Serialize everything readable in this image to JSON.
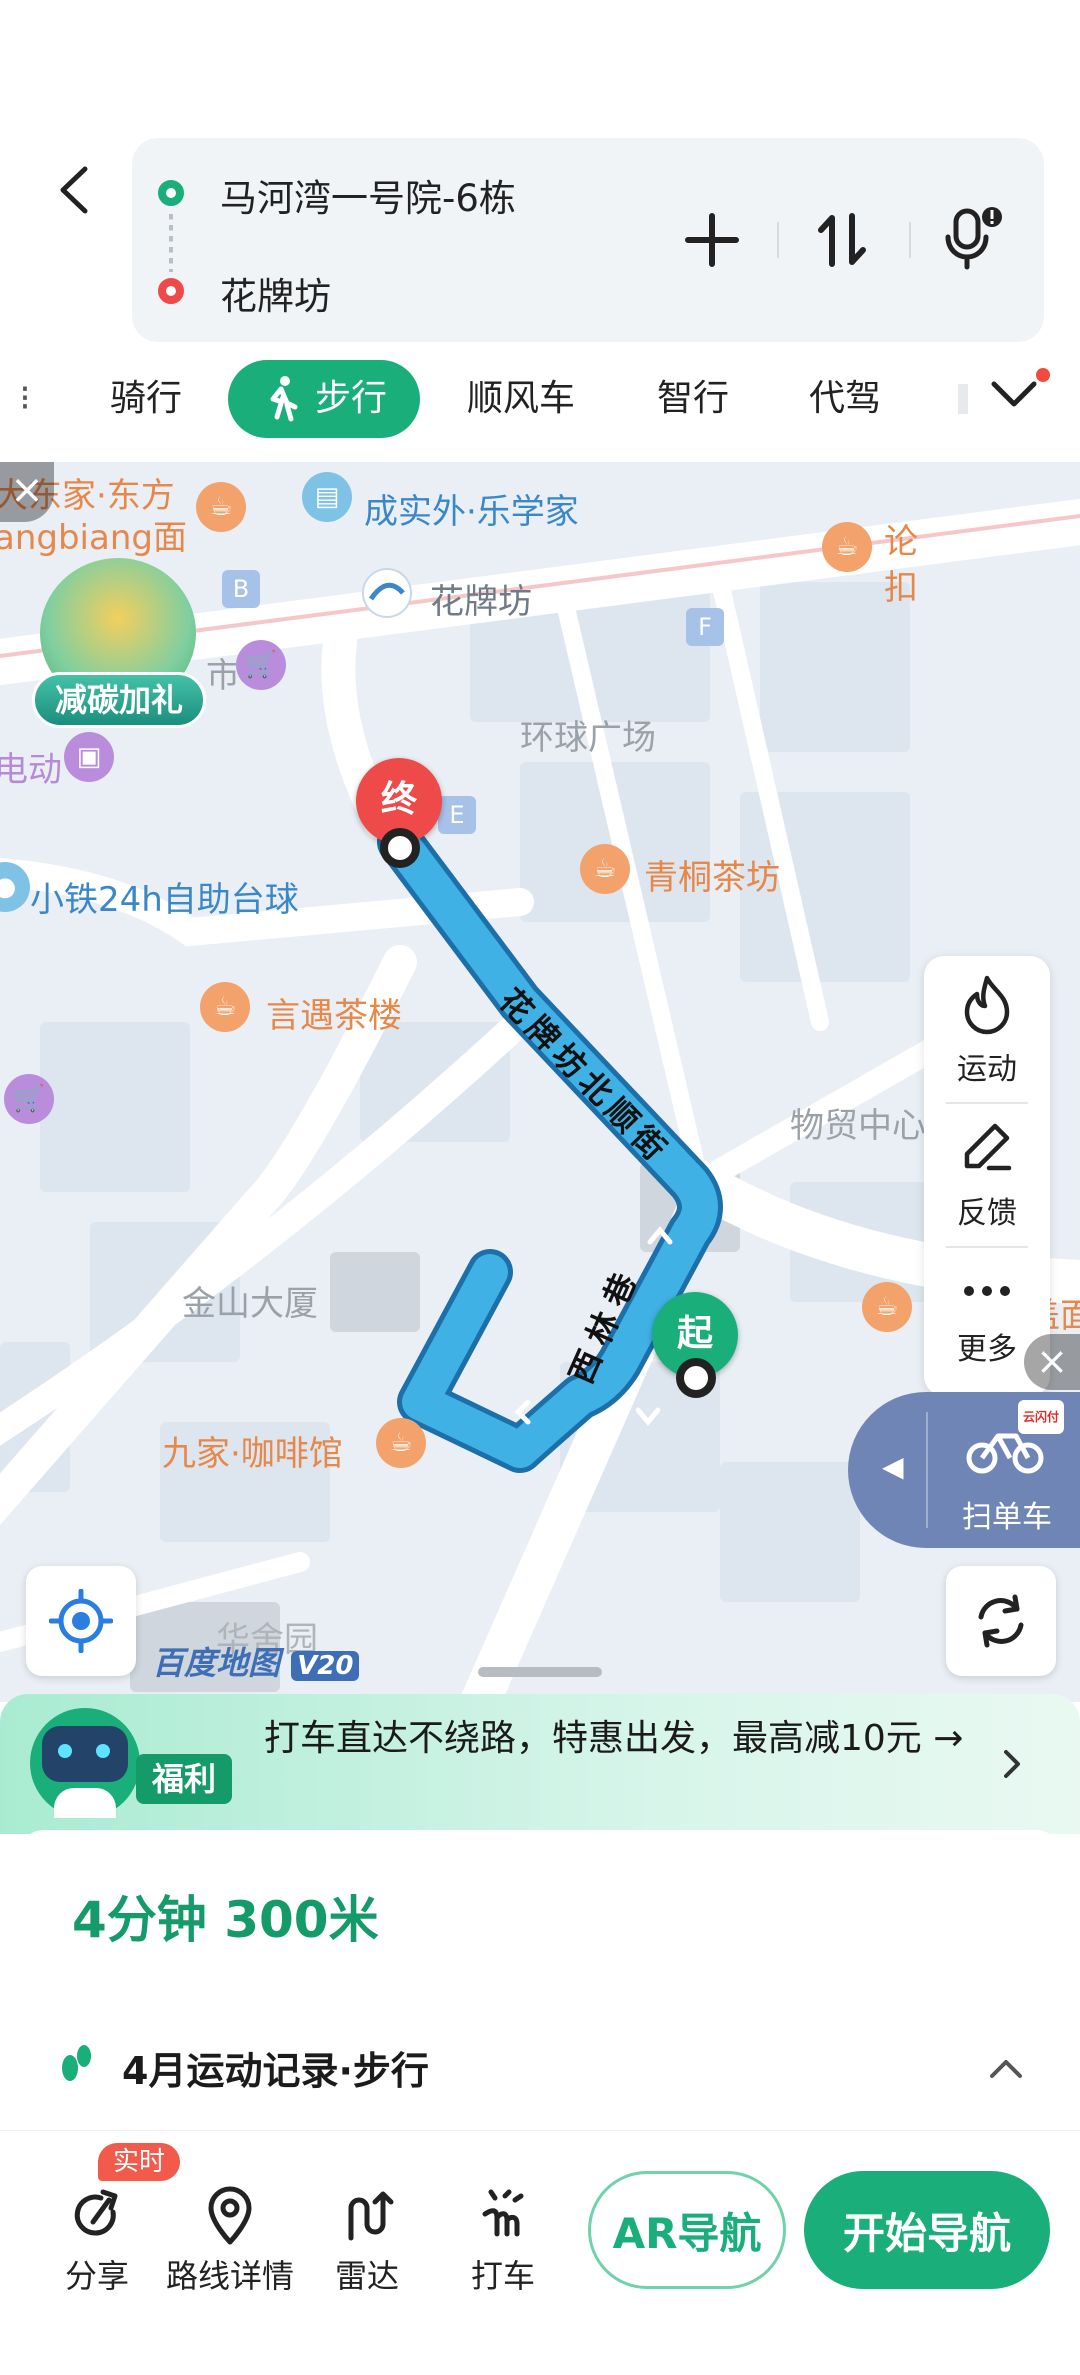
{
  "route": {
    "start": "马河湾一号院-6栋",
    "end": "花牌坊",
    "icons": [
      "back-arrow-icon",
      "plus-icon",
      "swap-icon",
      "microphone-icon"
    ]
  },
  "tabs": [
    "骑行",
    "步行",
    "顺风车",
    "智行",
    "代驾"
  ],
  "active_tab": "步行",
  "map": {
    "labels": {
      "l1": "大东家·东方",
      "l2": "angbiang面",
      "l3": "成实外·乐学家",
      "l4": "花牌坊",
      "l5": "论",
      "l6": "扣",
      "l7": "环球广场",
      "l8": "青桐茶坊",
      "l9": "小铁24h自助台球",
      "l10": "言遇茶楼",
      "l11": "物贸中心宿舍",
      "l12": "金山大厦",
      "l13": "重庆铺盖面",
      "l14": "九家·咖啡馆",
      "l15": "电动",
      "l16": "市",
      "l17": "华舍园",
      "road1": "花牌坊北顺街",
      "road2": "西林巷"
    },
    "promo_badge": "减碳加礼",
    "end_marker": "终",
    "start_marker": "起",
    "brand": "百度地图",
    "brand_version": "V20",
    "side_panel": {
      "sport": "运动",
      "feedback": "反馈",
      "more": "更多"
    },
    "bike_label": "扫单车",
    "bike_badge": "云闪付"
  },
  "banner": {
    "tag": "福利",
    "text": "打车直达不绕路，特惠出发，最高减10元 →"
  },
  "summary": {
    "eta": "4分钟 300米",
    "record": "4月运动记录·步行"
  },
  "bottom": {
    "realtime_badge": "实时",
    "share": "分享",
    "route_detail": "路线详情",
    "radar": "雷达",
    "taxi": "打车",
    "ar_nav": "AR导航",
    "start_nav": "开始导航"
  },
  "colors": {
    "accent": "#1aae7b",
    "route": "#3fb1e5",
    "end": "#ee4a4a"
  }
}
